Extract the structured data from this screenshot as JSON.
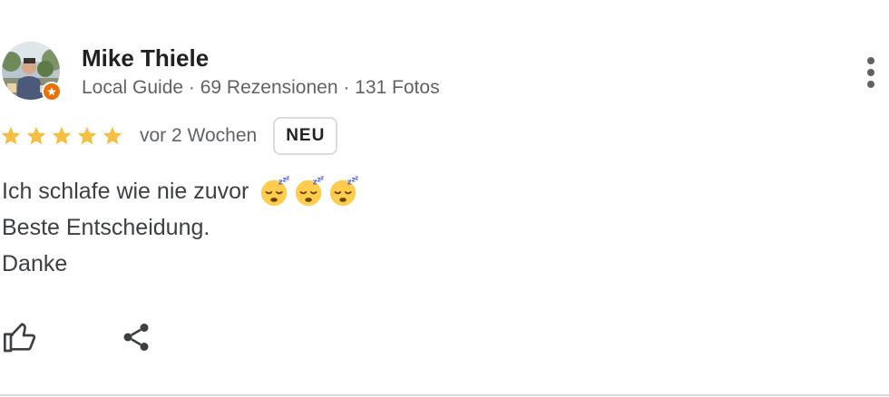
{
  "reviewer": {
    "name": "Mike Thiele",
    "meta": "Local Guide · 69 Rezensionen · 131 Fotos",
    "avatar_icon": "user-photo",
    "guide_badge_icon": "local-guide-star-icon",
    "guide_badge_color": "#e8710a"
  },
  "rating": {
    "stars": 5,
    "max_stars": 5,
    "star_color": "#f5bf42",
    "time": "vor 2 Wochen",
    "badge": "NEU"
  },
  "review": {
    "line1": "Ich schlafe wie nie zuvor",
    "line1_emojis": [
      "sleeping-face-emoji",
      "sleeping-face-emoji",
      "sleeping-face-emoji"
    ],
    "line2": "Beste Entscheidung.",
    "line3": "Danke"
  },
  "actions": {
    "like_icon": "thumbs-up-icon",
    "share_icon": "share-icon",
    "more_icon": "more-vert-icon"
  }
}
